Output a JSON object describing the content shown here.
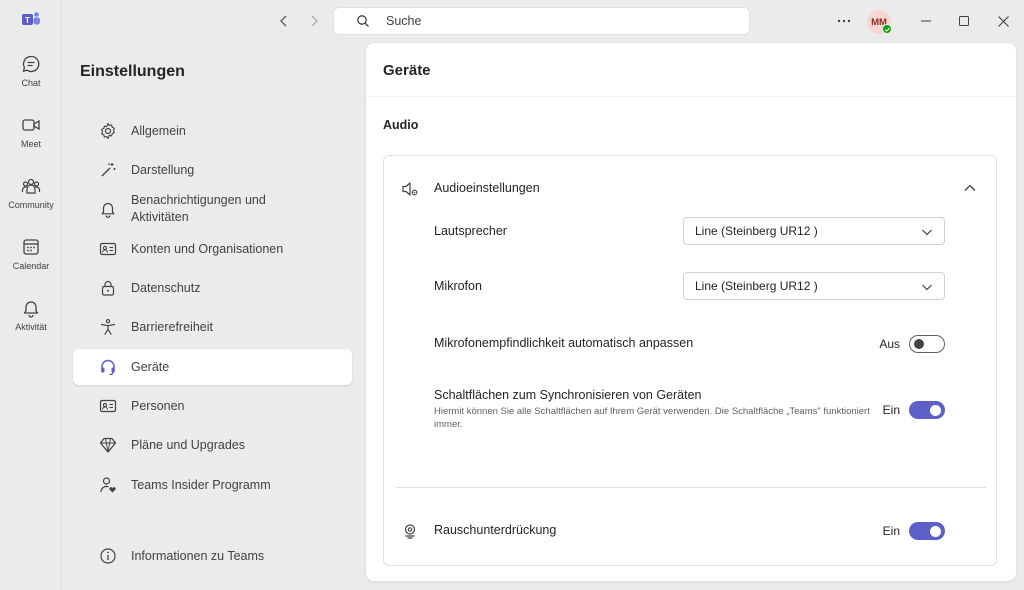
{
  "rail": {
    "items": [
      {
        "label": "Chat",
        "icon": "chat-icon"
      },
      {
        "label": "Meet",
        "icon": "video-icon"
      },
      {
        "label": "Community",
        "icon": "community-icon"
      },
      {
        "label": "Calendar",
        "icon": "calendar-icon"
      },
      {
        "label": "Aktivität",
        "icon": "bell-icon"
      }
    ]
  },
  "titlebar": {
    "search_placeholder": "Suche",
    "avatar_initials": "MM",
    "presence_color": "#13a10e"
  },
  "settings": {
    "title": "Einstellungen",
    "menu": [
      {
        "label": "Allgemein",
        "icon": "gear-icon"
      },
      {
        "label": "Darstellung",
        "icon": "magic-wand-icon"
      },
      {
        "label": "Benachrichtigungen und Aktivitäten",
        "icon": "bell-icon"
      },
      {
        "label": "Konten und Organisationen",
        "icon": "contact-card-icon"
      },
      {
        "label": "Datenschutz",
        "icon": "lock-icon"
      },
      {
        "label": "Barrierefreiheit",
        "icon": "accessibility-icon"
      },
      {
        "label": "Geräte",
        "icon": "headset-icon",
        "active": true
      },
      {
        "label": "Personen",
        "icon": "contact-card-icon"
      },
      {
        "label": "Pläne und Upgrades",
        "icon": "diamond-icon"
      },
      {
        "label": "Teams Insider Programm",
        "icon": "person-heart-icon"
      }
    ],
    "about": {
      "label": "Informationen zu Teams",
      "icon": "info-icon"
    }
  },
  "main": {
    "title": "Geräte",
    "section": "Audio",
    "audio_settings": {
      "title": "Audioeinstellungen",
      "speaker_label": "Lautsprecher",
      "speaker_value": "Line (Steinberg UR12 )",
      "mic_label": "Mikrofon",
      "mic_value": "Line (Steinberg UR12 )",
      "auto_adjust_label": "Mikrofonempfindlichkeit automatisch anpassen",
      "auto_adjust_state": "Aus",
      "sync_label": "Schaltflächen zum Synchronisieren von Geräten",
      "sync_desc": "Hiermit können Sie alle Schaltflächen auf Ihrem Gerät verwenden. Die Schaltfläche „Teams\" funktioniert immer.",
      "sync_state": "Ein"
    },
    "noise": {
      "label": "Rauschunterdrückung",
      "state": "Ein"
    },
    "accent_color": "#5b5fc7"
  }
}
